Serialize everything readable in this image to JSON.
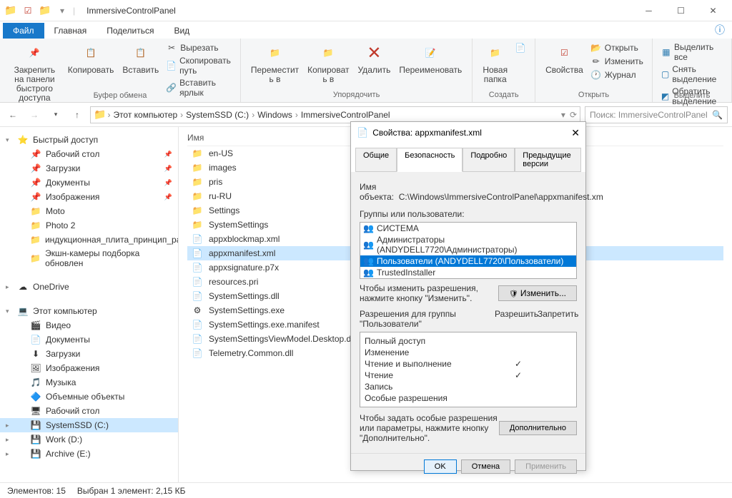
{
  "window": {
    "title": "ImmersiveControlPanel"
  },
  "menu": {
    "file": "Файл",
    "home": "Главная",
    "share": "Поделиться",
    "view": "Вид"
  },
  "ribbon": {
    "clipboard": {
      "pin": "Закрепить на панели\nбыстрого доступа",
      "copy": "Копировать",
      "paste": "Вставить",
      "cut": "Вырезать",
      "copypath": "Скопировать путь",
      "shortcut": "Вставить ярлык",
      "label": "Буфер обмена"
    },
    "organize": {
      "moveto": "Переместит\nь в",
      "copyto": "Копироват\nь в",
      "delete": "Удалить",
      "rename": "Переименовать",
      "label": "Упорядочить"
    },
    "new": {
      "folder": "Новая\nпапка",
      "label": "Создать"
    },
    "open": {
      "props": "Свойства",
      "open": "Открыть",
      "edit": "Изменить",
      "history": "Журнал",
      "label": "Открыть"
    },
    "select": {
      "all": "Выделить все",
      "none": "Снять выделение",
      "invert": "Обратить выделение",
      "label": "Выделить"
    }
  },
  "breadcrumb": [
    "Этот компьютер",
    "SystemSSD (C:)",
    "Windows",
    "ImmersiveControlPanel"
  ],
  "search_placeholder": "Поиск: ImmersiveControlPanel",
  "sidebar": {
    "quickaccess": "Быстрый доступ",
    "qa_items": [
      "Рабочий стол",
      "Загрузки",
      "Документы",
      "Изображения",
      "Moto",
      "Photo 2",
      "индукционная_плита_принцип_раб",
      "Экшн-камеры подборка обновлен"
    ],
    "onedrive": "OneDrive",
    "thispc": "Этот компьютер",
    "pc_items": [
      "Видео",
      "Документы",
      "Загрузки",
      "Изображения",
      "Музыка",
      "Объемные объекты",
      "Рабочий стол",
      "SystemSSD (C:)",
      "Work (D:)",
      "Archive (E:)"
    ]
  },
  "filecol": "Имя",
  "files": [
    {
      "n": "en-US",
      "t": "folder"
    },
    {
      "n": "images",
      "t": "folder"
    },
    {
      "n": "pris",
      "t": "folder"
    },
    {
      "n": "ru-RU",
      "t": "folder"
    },
    {
      "n": "Settings",
      "t": "folder"
    },
    {
      "n": "SystemSettings",
      "t": "folder"
    },
    {
      "n": "appxblockmap.xml",
      "t": "file"
    },
    {
      "n": "appxmanifest.xml",
      "t": "file",
      "sel": true
    },
    {
      "n": "appxsignature.p7x",
      "t": "file"
    },
    {
      "n": "resources.pri",
      "t": "file"
    },
    {
      "n": "SystemSettings.dll",
      "t": "file"
    },
    {
      "n": "SystemSettings.exe",
      "t": "exe"
    },
    {
      "n": "SystemSettings.exe.manifest",
      "t": "file"
    },
    {
      "n": "SystemSettingsViewModel.Desktop.dll",
      "t": "file"
    },
    {
      "n": "Telemetry.Common.dll",
      "t": "file"
    }
  ],
  "status": {
    "count": "Элементов: 15",
    "sel": "Выбран 1 элемент: 2,15 КБ"
  },
  "dialog": {
    "title": "Свойства: appxmanifest.xml",
    "tabs": [
      "Общие",
      "Безопасность",
      "Подробно",
      "Предыдущие версии"
    ],
    "active_tab": 1,
    "objlabel": "Имя объекта:",
    "objpath": "C:\\Windows\\ImmersiveControlPanel\\appxmanifest.xm",
    "groupslabel": "Группы или пользователи:",
    "groups": [
      "СИСТЕМА",
      "Администраторы (ANDYDELL7720\\Администраторы)",
      "Пользователи (ANDYDELL7720\\Пользователи)",
      "TrustedInstaller"
    ],
    "selected_group": 2,
    "changehint": "Чтобы изменить разрешения, нажмите кнопку \"Изменить\".",
    "changebtn": "Изменить...",
    "permlabel": "Разрешения для группы \"Пользователи\"",
    "allow": "Разрешить",
    "deny": "Запретить",
    "perms": [
      {
        "n": "Полный доступ",
        "a": false
      },
      {
        "n": "Изменение",
        "a": false
      },
      {
        "n": "Чтение и выполнение",
        "a": true
      },
      {
        "n": "Чтение",
        "a": true
      },
      {
        "n": "Запись",
        "a": false
      },
      {
        "n": "Особые разрешения",
        "a": false
      }
    ],
    "advhint": "Чтобы задать особые разрешения или параметры, нажмите кнопку \"Дополнительно\".",
    "advbtn": "Дополнительно",
    "ok": "OK",
    "cancel": "Отмена",
    "apply": "Применить"
  }
}
